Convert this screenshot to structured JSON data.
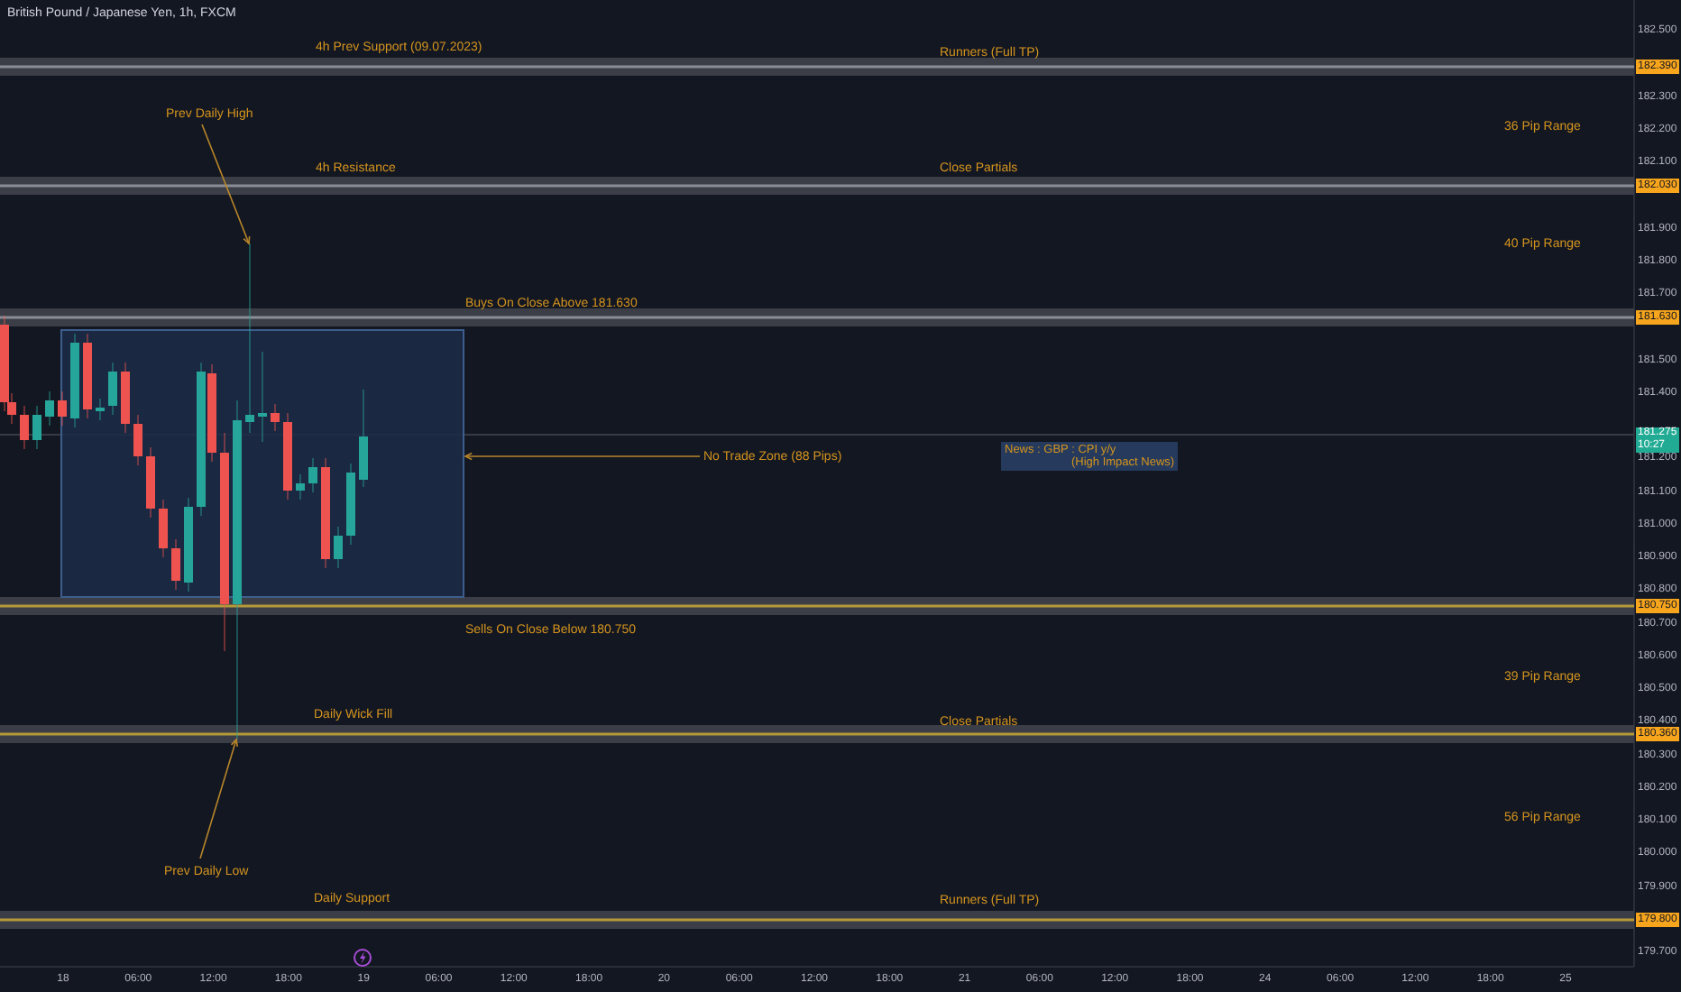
{
  "chart_title": "British Pound / Japanese Yen, 1h, FXCM",
  "levels": [
    {
      "price": "182.390",
      "color": "#8a8d95"
    },
    {
      "price": "182.030",
      "color": "#8a8d95"
    },
    {
      "price": "181.630",
      "color": "#8a8d95"
    },
    {
      "price": "180.750",
      "color": "#b59a3a"
    },
    {
      "price": "180.360",
      "color": "#b59a3a"
    },
    {
      "price": "179.800",
      "color": "#b59a3a"
    }
  ],
  "annotations": [
    {
      "kind": "label",
      "text": "4h Prev Support (09.07.2023)"
    },
    {
      "kind": "label",
      "text": "Runners (Full TP)"
    },
    {
      "kind": "arrow_label",
      "text": "Prev Daily High"
    },
    {
      "kind": "label",
      "text": "36 Pip Range"
    },
    {
      "kind": "label",
      "text": "4h Resistance"
    },
    {
      "kind": "label",
      "text": "Close Partials"
    },
    {
      "kind": "label",
      "text": "40 Pip Range"
    },
    {
      "kind": "label",
      "text": "Buys On Close Above 181.630"
    },
    {
      "kind": "arrow_label",
      "text": "No Trade Zone (88 Pips)"
    },
    {
      "kind": "label",
      "text": "Sells On Close Below 180.750"
    },
    {
      "kind": "label",
      "text": "39 Pip Range"
    },
    {
      "kind": "label",
      "text": "Daily Wick Fill"
    },
    {
      "kind": "label",
      "text": "Close Partials"
    },
    {
      "kind": "label",
      "text": "56 Pip Range"
    },
    {
      "kind": "arrow_label",
      "text": "Prev Daily Low"
    },
    {
      "kind": "label",
      "text": "Daily Support"
    },
    {
      "kind": "label",
      "text": "Runners (Full TP)"
    }
  ],
  "news": {
    "line_1": "News : GBP : CPI y/y",
    "line_2": "(High Impact News)"
  },
  "current_price": {
    "price": "181.275",
    "countdown": "10:27"
  },
  "price_axis": [
    "182.500",
    "182.300",
    "182.200",
    "182.100",
    "181.900",
    "181.800",
    "181.700",
    "181.500",
    "181.400",
    "181.200",
    "181.100",
    "181.000",
    "180.900",
    "180.800",
    "180.700",
    "180.600",
    "180.500",
    "180.400",
    "180.300",
    "180.200",
    "180.100",
    "180.000",
    "179.900",
    "179.700"
  ],
  "time_axis": [
    "18",
    "06:00",
    "12:00",
    "18:00",
    "19",
    "06:00",
    "12:00",
    "18:00",
    "20",
    "06:00",
    "12:00",
    "18:00",
    "21",
    "06:00",
    "12:00",
    "18:00",
    "24",
    "06:00",
    "12:00",
    "18:00",
    "25"
  ]
}
